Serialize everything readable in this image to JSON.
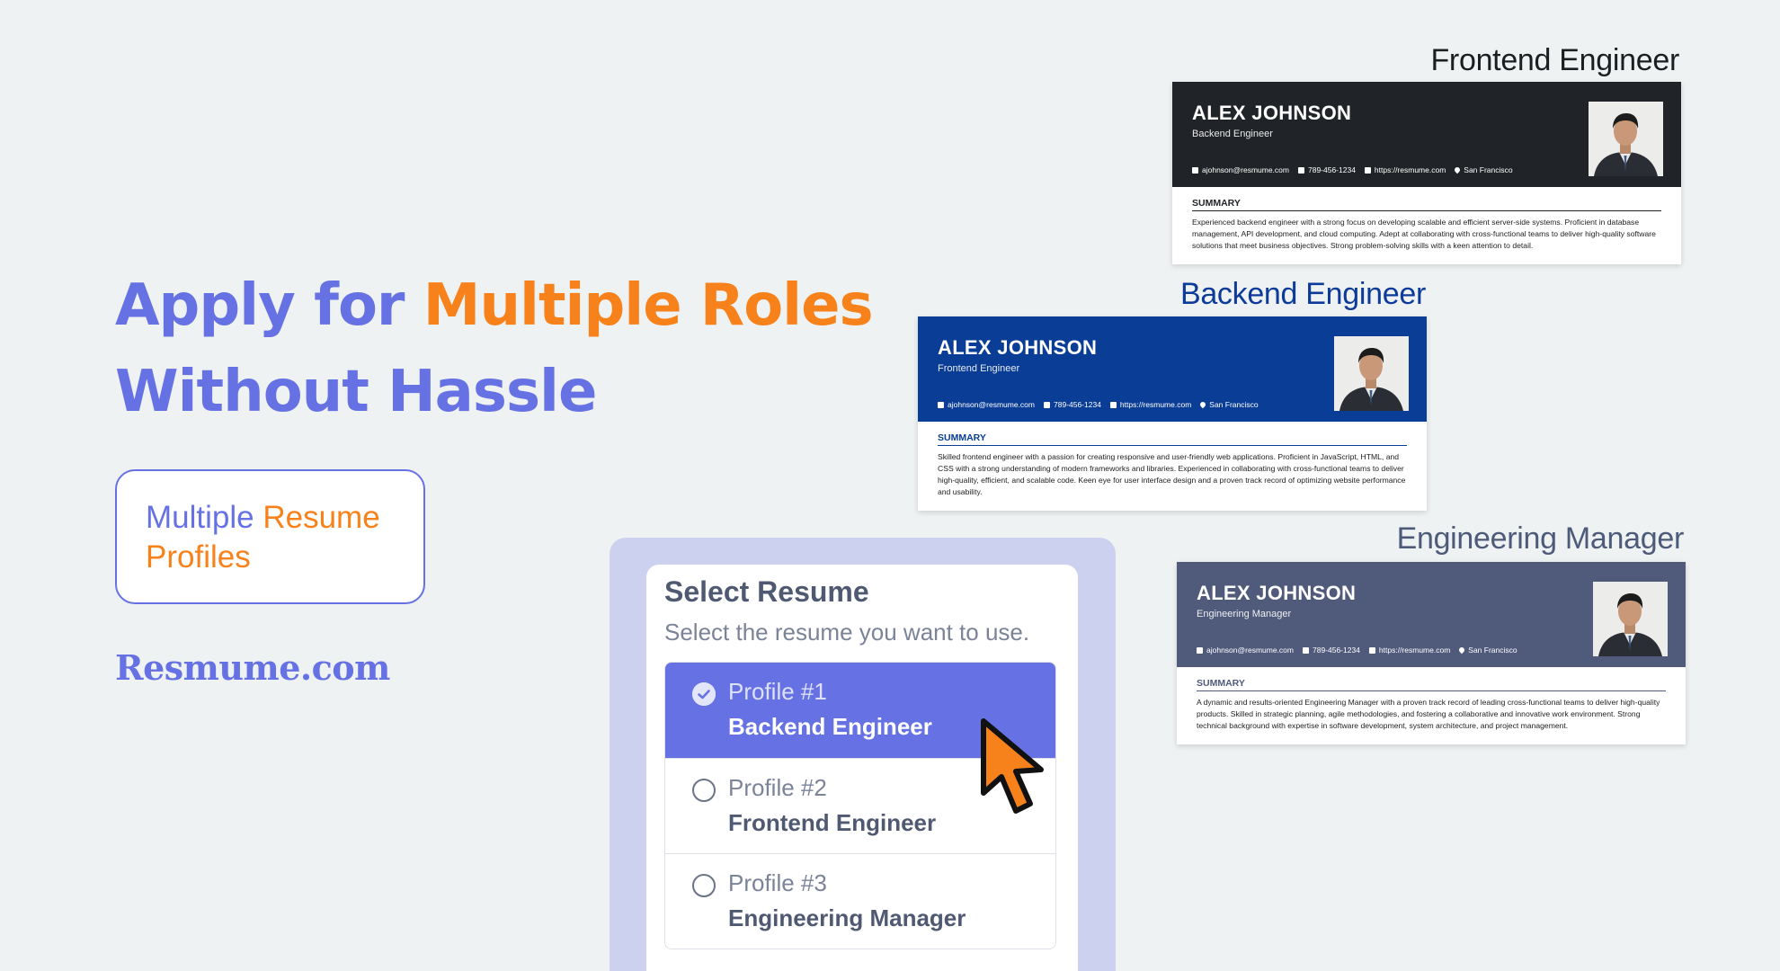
{
  "hero": {
    "line1_a": "Apply for",
    "line1_b": "Multiple Roles",
    "line2": "Without Hassle"
  },
  "feature": {
    "part1": "Multiple",
    "part2": "Resume",
    "part3": "Profiles"
  },
  "brand": "Resmume.com",
  "select": {
    "title": "Select Resume",
    "subtitle": "Select the resume you want to use.",
    "options": [
      {
        "num": "Profile #1",
        "role": "Backend Engineer",
        "selected": true
      },
      {
        "num": "Profile #2",
        "role": "Frontend Engineer",
        "selected": false
      },
      {
        "num": "Profile #3",
        "role": "Engineering Manager",
        "selected": false
      }
    ]
  },
  "contact": {
    "email": "ajohnson@resmume.com",
    "phone": "789-456-1234",
    "site": "https://resmume.com",
    "city": "San Francisco"
  },
  "resumes": [
    {
      "label": "Frontend Engineer",
      "label_color": "#1d1e22",
      "header_color": "#202327",
      "accent": "#202327",
      "name": "ALEX JOHNSON",
      "title": "Backend Engineer",
      "summary_heading": "SUMMARY",
      "summary": "Experienced backend engineer with a strong focus on developing scalable and efficient server-side systems. Proficient in database management, API development, and cloud computing. Adept at collaborating with cross-functional teams to deliver high-quality software solutions that meet business objectives. Strong problem-solving skills with a keen attention to detail."
    },
    {
      "label": "Backend Engineer",
      "label_color": "#0d3b9a",
      "header_color": "#0a3d96",
      "accent": "#0a3d96",
      "name": "ALEX JOHNSON",
      "title": "Frontend Engineer",
      "summary_heading": "SUMMARY",
      "summary": "Skilled frontend engineer with a passion for creating responsive and user-friendly web applications. Proficient in JavaScript, HTML, and CSS with a strong understanding of modern frameworks and libraries. Experienced in collaborating with cross-functional teams to deliver high-quality, efficient, and scalable code. Keen eye for user interface design and a proven track record of optimizing website performance and usability."
    },
    {
      "label": "Engineering Manager",
      "label_color": "#4d5a79",
      "header_color": "#505b7c",
      "accent": "#505b7c",
      "name": "ALEX JOHNSON",
      "title": "Engineering Manager",
      "summary_heading": "SUMMARY",
      "summary": "A dynamic and results-oriented Engineering Manager with a proven track record of leading cross-functional teams to deliver high-quality products. Skilled in strategic planning, agile methodologies, and fostering a collaborative and innovative work environment. Strong technical background with expertise in software development, system architecture, and project management."
    }
  ]
}
